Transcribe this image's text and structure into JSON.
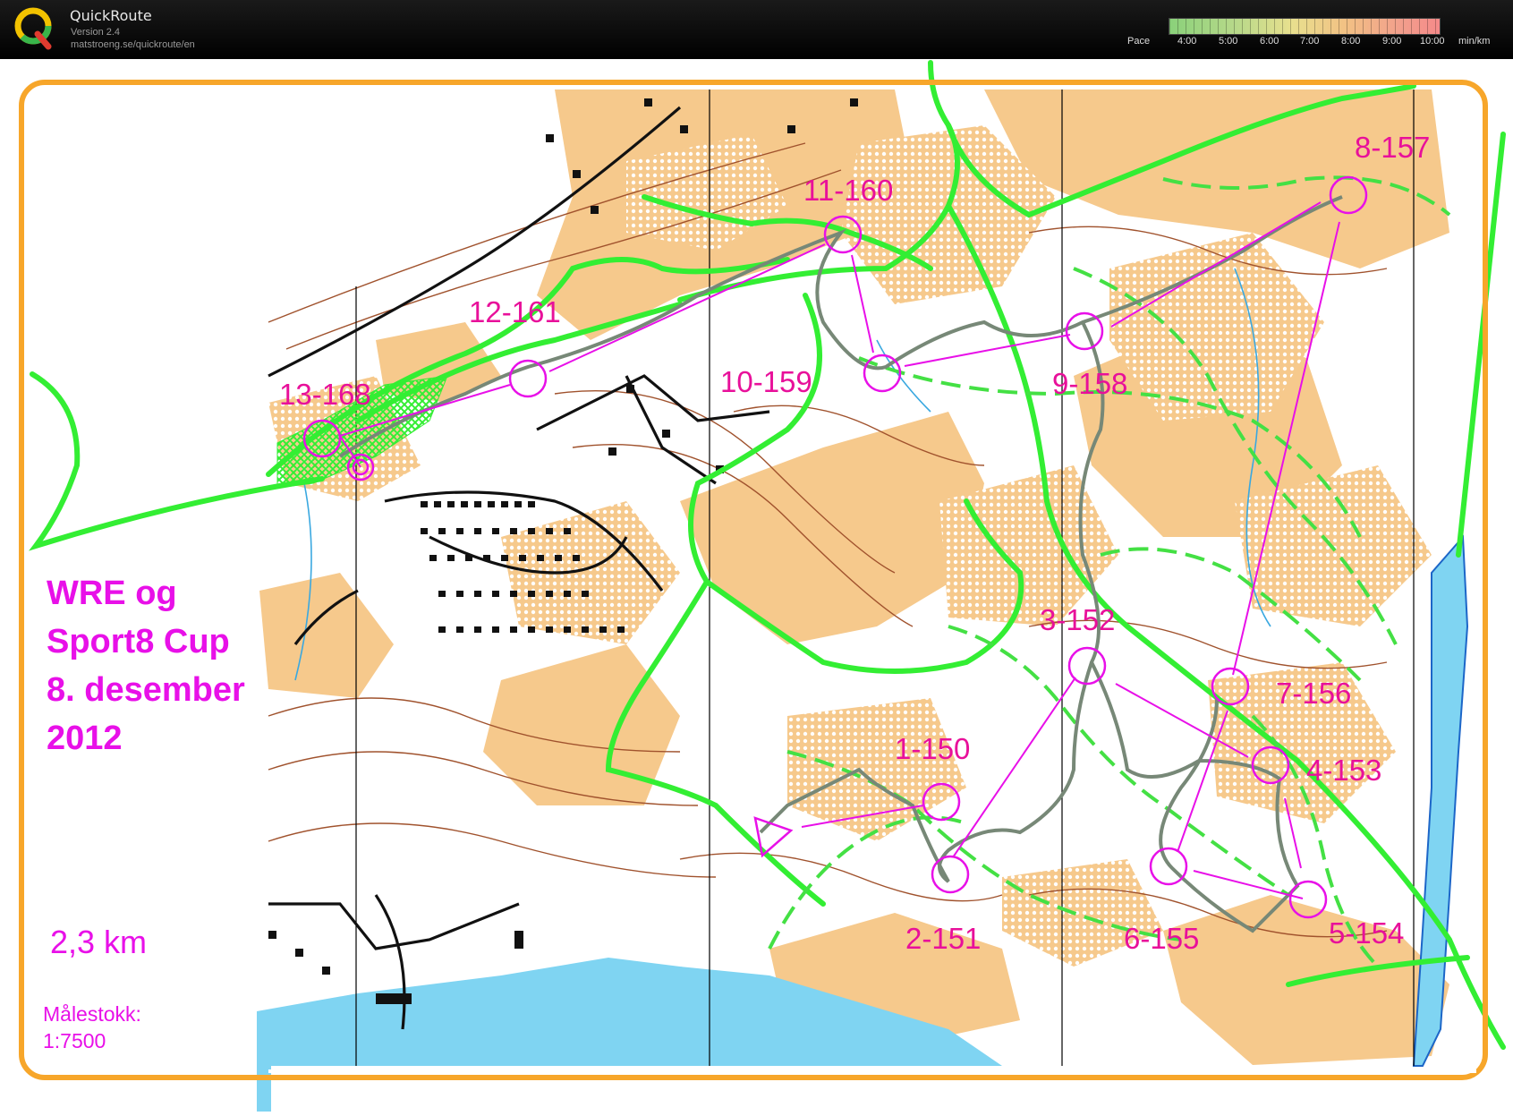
{
  "app": {
    "title": "QuickRoute",
    "version": "Version 2.4",
    "url": "matstroeng.se/quickroute/en"
  },
  "pace": {
    "label": "Pace",
    "ticks": [
      "4:00",
      "5:00",
      "6:00",
      "7:00",
      "8:00",
      "9:00",
      "10:00"
    ],
    "unit": "min/km"
  },
  "event": {
    "lines": [
      "WRE og",
      "Sport8 Cup",
      "8. desember",
      "2012"
    ],
    "distance": "2,3 km",
    "scale_label": "Målestokk:",
    "scale_value": "1:7500"
  },
  "controls": [
    {
      "label": "1-150"
    },
    {
      "label": "2-151"
    },
    {
      "label": "3-152"
    },
    {
      "label": "4-153"
    },
    {
      "label": "5-154"
    },
    {
      "label": "6-155"
    },
    {
      "label": "7-156"
    },
    {
      "label": "8-157"
    },
    {
      "label": "9-158"
    },
    {
      "label": "10-159"
    },
    {
      "label": "11-160"
    },
    {
      "label": "12-161"
    },
    {
      "label": "13-168"
    }
  ],
  "colors": {
    "course": "#e810e8",
    "track": "#33ee33",
    "frame": "#f7a62a",
    "vegetation": "#f6c98c",
    "water": "#7fd4f2"
  }
}
